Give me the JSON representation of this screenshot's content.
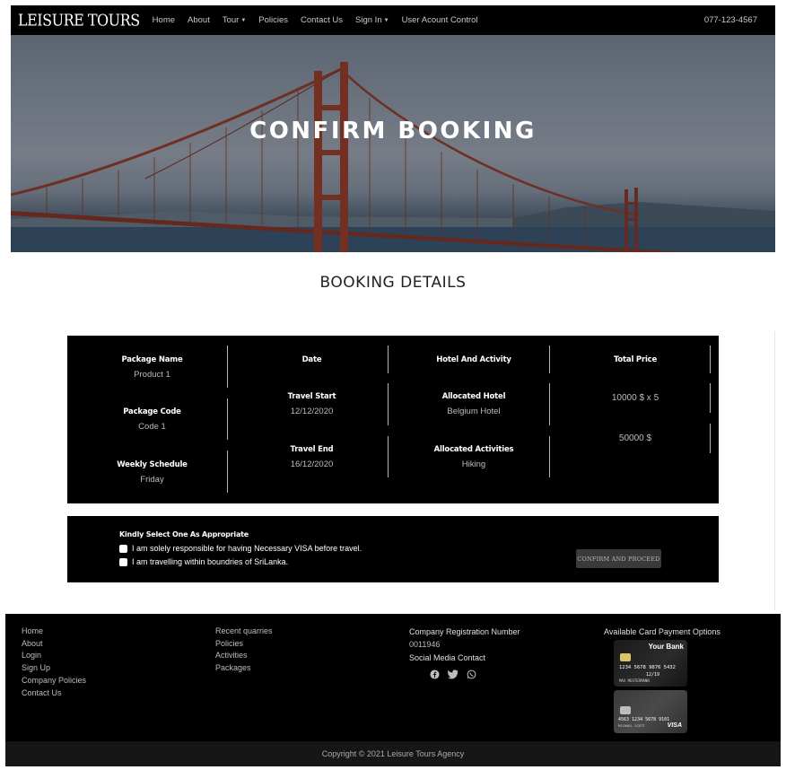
{
  "nav": {
    "brand": "LEISURE TOURS",
    "items": [
      "Home",
      "About",
      "Tour",
      "Policies",
      "Contact Us",
      "Sign In",
      "User Acount Control"
    ],
    "phone": "077-123-4567"
  },
  "hero": {
    "title": "CONFIRM BOOKING"
  },
  "section_title": "BOOKING DETAILS",
  "booking": {
    "package_name_label": "Package Name",
    "package_name": "Product 1",
    "package_code_label": "Package Code",
    "package_code": "Code 1",
    "weekly_schedule_label": "Weekly Schedule",
    "weekly_schedule": "Friday",
    "date_label": "Date",
    "travel_start_label": "Travel Start",
    "travel_start": "12/12/2020",
    "travel_end_label": "Travel End",
    "travel_end": "16/12/2020",
    "hotel_activity_label": "Hotel And Activity",
    "hotel_label": "Allocated Hotel",
    "hotel": "Belgium Hotel",
    "activities_label": "Allocated Activities",
    "activities": "Hiking",
    "total_price_label": "Total Price",
    "price_calc": "10000 $ x 5",
    "total_price": "50000 $"
  },
  "confirm": {
    "heading": "Kindly Select One As Appropriate",
    "option1": "I am solely responsible for having Necessary VISA before travel.",
    "option2": "I am travelling within boundries of SriLanka.",
    "button": "CONFIRM AND PROCEED"
  },
  "footer": {
    "col1": [
      "Home",
      "About",
      "Login",
      "Sign Up",
      "Company Policies",
      "Contact Us"
    ],
    "col2": [
      "Recent quarries",
      "Policies",
      "Activities",
      "Packages"
    ],
    "reg_label": "Company Registration Number",
    "reg_number": "0011946",
    "social_label": "Social Media Contact",
    "social_icons": [
      "facebook-icon",
      "twitter-icon",
      "whatsapp-icon"
    ],
    "payment_label": "Available Card Payment Options",
    "card1": {
      "bank": "Your Bank",
      "number": "1234 5678 9876 5432",
      "expiry": "12/19",
      "holder": "MAX MUSTERMANN"
    },
    "card2": {
      "number": "4563 1234 5678 9101",
      "holder": "MICHAEL SCOTT",
      "brand": "VISA"
    },
    "copyright": "Copyright © 2021 Leisure Tours Agency"
  }
}
